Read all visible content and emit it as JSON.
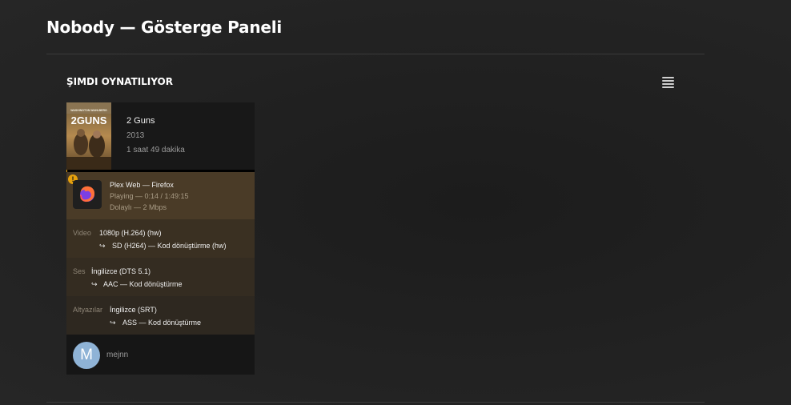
{
  "header": {
    "title": "Nobody — Gösterge Paneli"
  },
  "now_playing": {
    "title": "ŞIMDI OYNATILIYOR",
    "toggle_icon": "list-view-icon",
    "session": {
      "movie": {
        "title": "2 Guns",
        "year": "2013",
        "duration": "1 saat 49 dakika",
        "poster": {
          "text_top": "WASHINGTON  WAHLBERG",
          "text_main": "2GUNS"
        }
      },
      "progress_fraction": 0.002,
      "player": {
        "name": "Plex Web  —  Firefox",
        "state": "Playing — 0:14 / 1:49:15",
        "stream": "Dolaylı — 2 Mbps",
        "icon": "firefox-icon",
        "warning_icon": "warning-icon",
        "warning_symbol": "!"
      },
      "video": {
        "label": "Video",
        "value": "1080p (H.264) (hw)",
        "arrow": "↪",
        "transcode": "SD (H264) — Kod dönüştürme (hw)"
      },
      "audio": {
        "label": "Ses",
        "value": "İngilizce (DTS 5.1)",
        "arrow": "↪",
        "transcode": "AAC — Kod dönüştürme"
      },
      "subtitles": {
        "label": "Altyazılar",
        "value": "İngilizce (SRT)",
        "arrow": "↪",
        "transcode": "ASS — Kod dönüştürme"
      },
      "user": {
        "avatar_letter": "M",
        "name": "mejnn"
      }
    }
  },
  "colors": {
    "accent": "#e5a00d",
    "background": "#222222",
    "avatar": "#8fb3d6"
  }
}
